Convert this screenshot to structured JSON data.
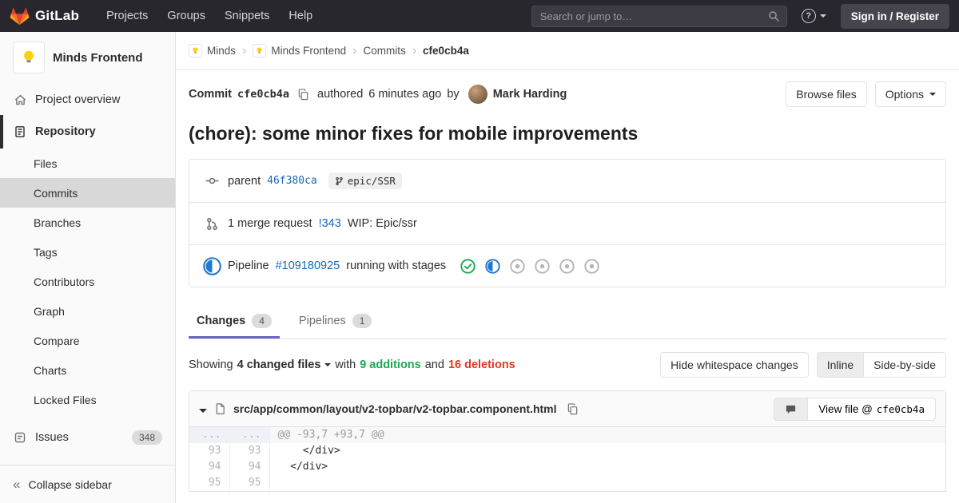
{
  "colors": {
    "brand_red": "#e24329",
    "brand_orange": "#fc6d26",
    "brand_yellow": "#fca326",
    "link_blue": "#1b69b6",
    "additions_green": "#1aaa55",
    "deletions_red": "#db3b21",
    "running_blue": "#1f78d1",
    "active_tab_indicator": "#6666c4"
  },
  "navbar": {
    "brand": "GitLab",
    "menu": [
      "Projects",
      "Groups",
      "Snippets",
      "Help"
    ],
    "search_placeholder": "Search or jump to…",
    "help_icon_text": "?",
    "sign_in_label": "Sign in / Register"
  },
  "sidebar": {
    "project_name": "Minds Frontend",
    "overview_label": "Project overview",
    "repository_label": "Repository",
    "repo_items": [
      "Files",
      "Commits",
      "Branches",
      "Tags",
      "Contributors",
      "Graph",
      "Compare",
      "Charts",
      "Locked Files"
    ],
    "active_repo_item": "Commits",
    "issues_label": "Issues",
    "issues_count": "348",
    "collapse_label": "Collapse sidebar"
  },
  "breadcrumbs": {
    "group": "Minds",
    "project": "Minds Frontend",
    "section": "Commits",
    "current": "cfe0cb4a"
  },
  "commit": {
    "label": "Commit",
    "sha": "cfe0cb4a",
    "authored_prefix": "authored",
    "time_ago": "6 minutes ago",
    "by_word": "by",
    "author": "Mark Harding",
    "browse_files_label": "Browse files",
    "options_label": "Options",
    "message": "(chore): some minor fixes for mobile improvements"
  },
  "details": {
    "parent_label": "parent",
    "parent_sha": "46f380ca",
    "branch_ref": "epic/SSR",
    "mr_count_text": "1 merge request",
    "mr_ref": "!343",
    "mr_title": "WIP: Epic/ssr",
    "pipeline_label": "Pipeline",
    "pipeline_id": "#109180925",
    "pipeline_status_text": "running with stages",
    "stage_statuses": [
      "passed",
      "running",
      "created",
      "created",
      "created",
      "created"
    ]
  },
  "tabs": {
    "changes_label": "Changes",
    "changes_count": "4",
    "pipelines_label": "Pipelines",
    "pipelines_count": "1"
  },
  "diff_summary": {
    "showing_word": "Showing",
    "files_dropdown": "4 changed files",
    "with_word": "with",
    "additions_text": "9 additions",
    "and_word": "and",
    "deletions_text": "16 deletions",
    "hide_whitespace_label": "Hide whitespace changes",
    "inline_label": "Inline",
    "side_by_side_label": "Side-by-side"
  },
  "diff_file": {
    "path": "src/app/common/layout/v2-topbar/v2-topbar.component.html",
    "view_file_label": "View file @",
    "view_file_sha": "cfe0cb4a",
    "hunk_header": "@@ -93,7 +93,7 @@",
    "hunk_old_marker": "...",
    "hunk_new_marker": "...",
    "lines": [
      {
        "old": "93",
        "new": "93",
        "code": "    </div>"
      },
      {
        "old": "94",
        "new": "94",
        "code": "  </div>"
      },
      {
        "old": "95",
        "new": "95",
        "code": ""
      }
    ]
  }
}
